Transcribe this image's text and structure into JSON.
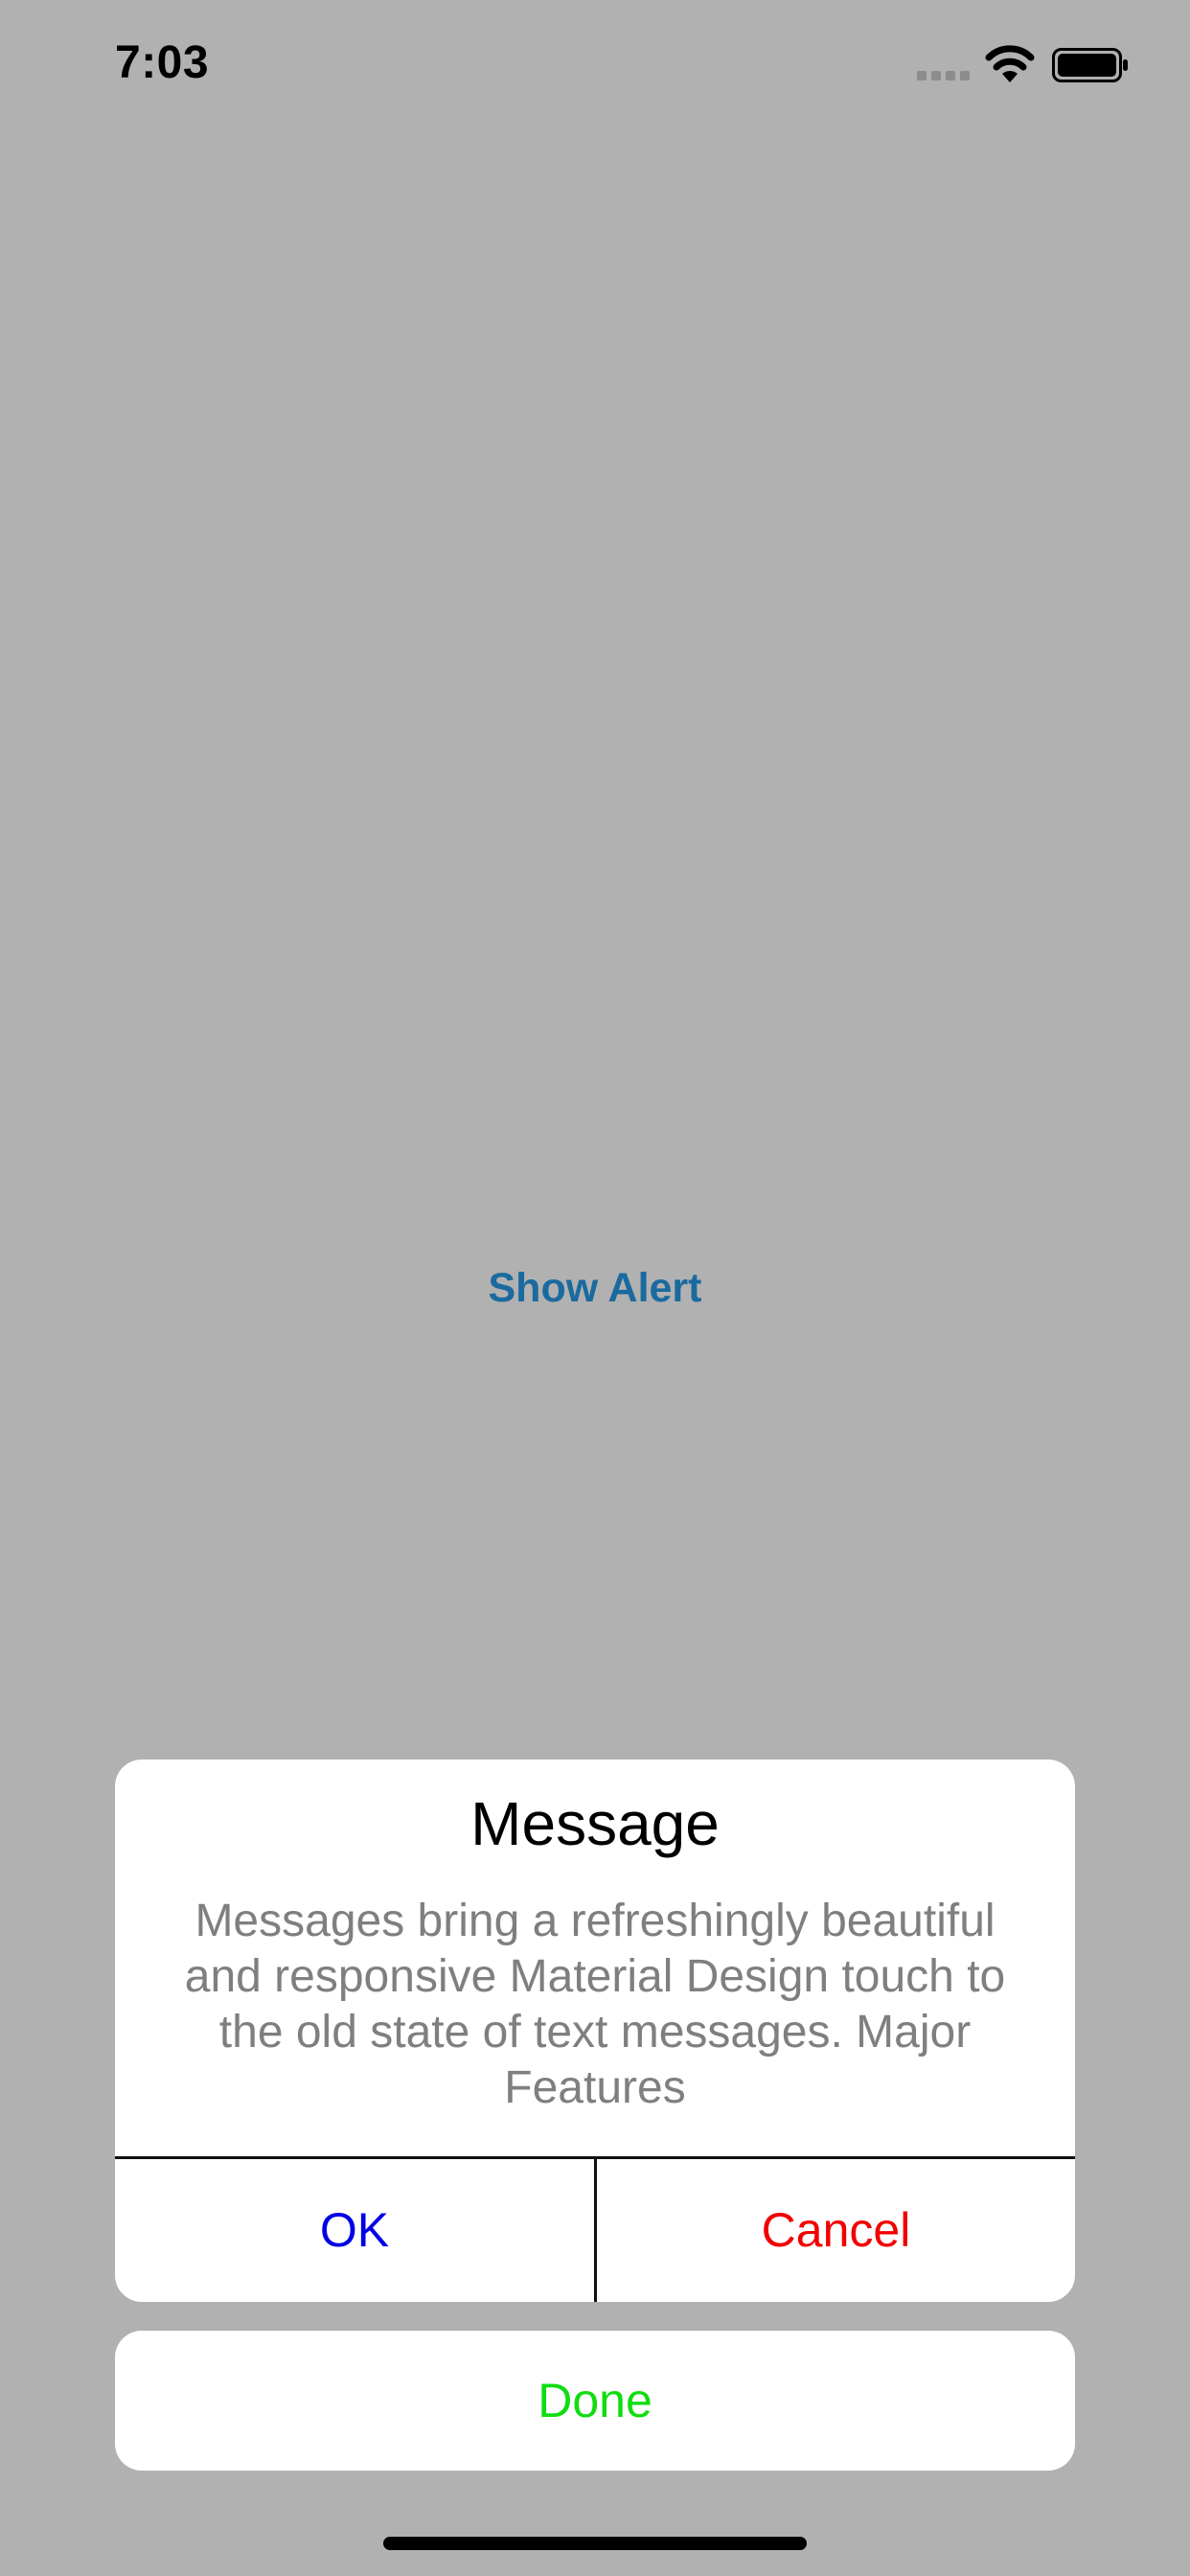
{
  "status_bar": {
    "time": "7:03"
  },
  "main": {
    "show_alert_label": "Show Alert"
  },
  "alert": {
    "title": "Message",
    "message": "Messages bring a refreshingly beautiful and responsive Material Design touch to the old state of text messages. Major Features",
    "ok_label": "OK",
    "cancel_label": "Cancel",
    "done_label": "Done"
  },
  "colors": {
    "background": "#b1b1b1",
    "show_alert": "#1a6a9f",
    "ok": "#0000e6",
    "cancel": "#f20000",
    "done": "#10dd10",
    "message": "#7f7f7f"
  },
  "icons": {
    "signal": "cellular-signal-icon",
    "wifi": "wifi-icon",
    "battery": "battery-icon"
  }
}
